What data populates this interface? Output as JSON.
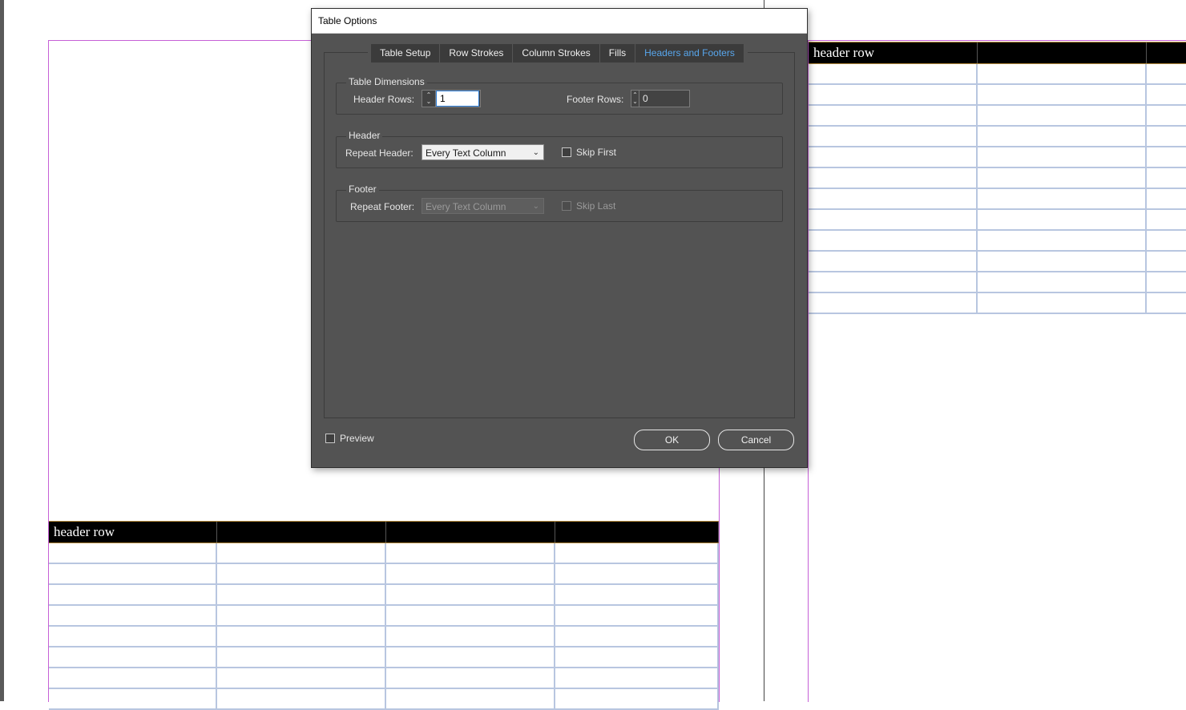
{
  "document": {
    "left_table": {
      "header_text": "header row",
      "columns": 4,
      "body_rows": 8
    },
    "right_table": {
      "header_text": "header row",
      "columns": 3,
      "body_rows": 12
    }
  },
  "dialog": {
    "title": "Table Options",
    "tabs": [
      {
        "label": "Table Setup",
        "active": false
      },
      {
        "label": "Row Strokes",
        "active": false
      },
      {
        "label": "Column Strokes",
        "active": false
      },
      {
        "label": "Fills",
        "active": false
      },
      {
        "label": "Headers and Footers",
        "active": true
      }
    ],
    "table_dimensions": {
      "title": "Table Dimensions",
      "header_rows_label": "Header Rows:",
      "header_rows_value": "1",
      "footer_rows_label": "Footer Rows:",
      "footer_rows_value": "0"
    },
    "header": {
      "title": "Header",
      "repeat_label": "Repeat Header:",
      "repeat_value": "Every Text Column",
      "skip_label": "Skip First",
      "skip_checked": false
    },
    "footer": {
      "title": "Footer",
      "repeat_label": "Repeat Footer:",
      "repeat_value": "Every Text Column",
      "skip_label": "Skip Last",
      "skip_checked": false,
      "disabled": true
    },
    "preview_label": "Preview",
    "preview_checked": false,
    "ok_label": "OK",
    "cancel_label": "Cancel"
  },
  "colors": {
    "dialog_bg": "#535353",
    "active_tab_text": "#58a6ec",
    "page_frame": "#c660d6",
    "table_grid": "#b8c6e0",
    "header_row_bg": "#000000"
  }
}
